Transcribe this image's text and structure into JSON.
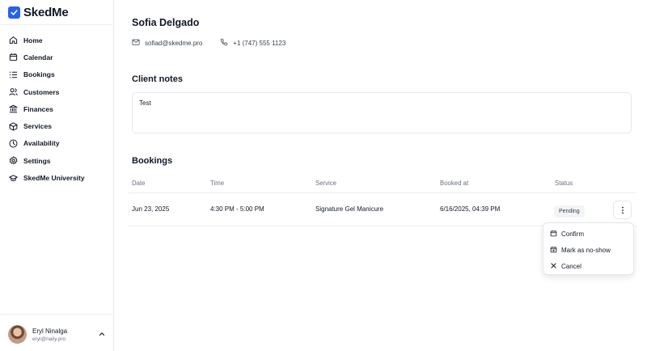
{
  "app": {
    "name": "SkedMe",
    "accent": "#2563eb"
  },
  "sidebar": {
    "items": [
      {
        "label": "Home",
        "icon": "home-icon"
      },
      {
        "label": "Calendar",
        "icon": "calendar-icon"
      },
      {
        "label": "Bookings",
        "icon": "list-icon"
      },
      {
        "label": "Customers",
        "icon": "users-icon"
      },
      {
        "label": "Finances",
        "icon": "bank-icon"
      },
      {
        "label": "Services",
        "icon": "box-icon"
      },
      {
        "label": "Availability",
        "icon": "clock-icon"
      },
      {
        "label": "Settings",
        "icon": "gear-icon"
      },
      {
        "label": "SkedMe University",
        "icon": "graduation-cap-icon"
      }
    ]
  },
  "user": {
    "name": "Eryl Ninalga",
    "email": "eryl@naily.pro"
  },
  "client": {
    "name": "Sofia Delgado",
    "email": "sofiad@skedme.pro",
    "phone": "+1 (747) 555 1123"
  },
  "notes": {
    "title": "Client notes",
    "text": "Test"
  },
  "bookings": {
    "title": "Bookings",
    "columns": [
      "Date",
      "Time",
      "Service",
      "Booked at",
      "Status"
    ],
    "rows": [
      {
        "date": "Jun 23, 2025",
        "time": "4:30 PM - 5:00 PM",
        "service": "Signature Gel Manicure",
        "booked_at": "6/16/2025, 04:39 PM",
        "status": "Pending"
      }
    ]
  },
  "row_menu": {
    "items": [
      {
        "label": "Confirm",
        "icon": "calendar-check-icon"
      },
      {
        "label": "Mark as no-show",
        "icon": "calendar-x-icon"
      },
      {
        "label": "Cancel",
        "icon": "close-icon"
      }
    ]
  }
}
